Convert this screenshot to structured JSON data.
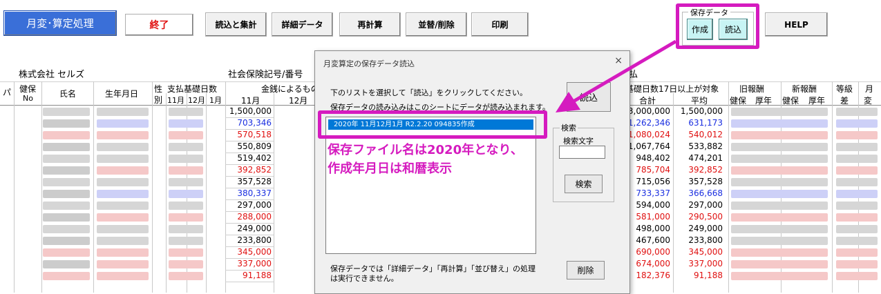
{
  "toolbar": {
    "main_label": "月変･算定処理",
    "end_label": "終了",
    "read_sum_label": "読込と集計",
    "detail_label": "詳細データ",
    "recalc_label": "再計算",
    "sort_delete_label": "並替/削除",
    "print_label": "印刷",
    "saved_group_label": "保存データ",
    "create_label": "作成",
    "load_label": "読込",
    "help_label": "HELP"
  },
  "sheet": {
    "company": "株式会社  セルズ",
    "insurance_no_label": "社会保険記号/番号",
    "pay_label": "払",
    "col_pa": "パ",
    "col_kenpo": "健保",
    "col_no": "No",
    "col_name": "氏名",
    "col_birth": "生年月日",
    "col_sex_top": "性",
    "col_sex_bottom": "別",
    "col_days_title": "支払基礎日数",
    "col_m11": "11月",
    "col_m12": "12月",
    "col_m1": "1月",
    "col_money_title": "金銭によるもの",
    "col_money_11": "11月",
    "col_money_12": "12月",
    "col_17days": "基礎日数17日以上が対象",
    "col_total": "合計",
    "col_avg": "平均",
    "col_old": "旧報酬",
    "col_new": "新報酬",
    "col_grade": "等級",
    "col_month": "月",
    "col_kenpo2": "健保",
    "col_kosei": "厚年",
    "col_kenpo3": "健保",
    "col_kosei2": "厚年",
    "col_diff": "差",
    "col_change": "変",
    "money_11": [
      {
        "v": "1,500,000",
        "c": "#000000"
      },
      {
        "v": "703,346",
        "c": "#1a2ee0"
      },
      {
        "v": "570,518",
        "c": "#e01010"
      },
      {
        "v": "550,809",
        "c": "#000000"
      },
      {
        "v": "519,402",
        "c": "#000000"
      },
      {
        "v": "392,852",
        "c": "#e01010"
      },
      {
        "v": "357,528",
        "c": "#000000"
      },
      {
        "v": "380,337",
        "c": "#1a2ee0"
      },
      {
        "v": "297,000",
        "c": "#000000"
      },
      {
        "v": "288,000",
        "c": "#e01010"
      },
      {
        "v": "249,000",
        "c": "#000000"
      },
      {
        "v": "233,800",
        "c": "#000000"
      },
      {
        "v": "345,000",
        "c": "#e01010"
      },
      {
        "v": "337,000",
        "c": "#e01010"
      },
      {
        "v": "91,188",
        "c": "#e01010"
      }
    ],
    "totals": [
      {
        "v": "3,000,000",
        "c": "#000000"
      },
      {
        "v": "1,262,346",
        "c": "#1a2ee0"
      },
      {
        "v": "1,080,024",
        "c": "#e01010"
      },
      {
        "v": "1,067,764",
        "c": "#000000"
      },
      {
        "v": "948,402",
        "c": "#000000"
      },
      {
        "v": "785,704",
        "c": "#e01010"
      },
      {
        "v": "715,056",
        "c": "#000000"
      },
      {
        "v": "733,337",
        "c": "#1a2ee0"
      },
      {
        "v": "594,000",
        "c": "#000000"
      },
      {
        "v": "581,000",
        "c": "#e01010"
      },
      {
        "v": "498,000",
        "c": "#000000"
      },
      {
        "v": "467,600",
        "c": "#000000"
      },
      {
        "v": "690,000",
        "c": "#e01010"
      },
      {
        "v": "674,000",
        "c": "#e01010"
      },
      {
        "v": "182,376",
        "c": "#e01010"
      }
    ],
    "avgs": [
      {
        "v": "1,500,000",
        "c": "#000000"
      },
      {
        "v": "631,173",
        "c": "#1a2ee0"
      },
      {
        "v": "540,012",
        "c": "#e01010"
      },
      {
        "v": "533,882",
        "c": "#000000"
      },
      {
        "v": "474,201",
        "c": "#000000"
      },
      {
        "v": "392,852",
        "c": "#e01010"
      },
      {
        "v": "357,528",
        "c": "#000000"
      },
      {
        "v": "366,668",
        "c": "#1a2ee0"
      },
      {
        "v": "297,000",
        "c": "#000000"
      },
      {
        "v": "290,500",
        "c": "#e01010"
      },
      {
        "v": "249,000",
        "c": "#000000"
      },
      {
        "v": "233,800",
        "c": "#000000"
      },
      {
        "v": "345,000",
        "c": "#e01010"
      },
      {
        "v": "337,000",
        "c": "#e01010"
      },
      {
        "v": "91,188",
        "c": "#e01010"
      }
    ]
  },
  "dialog": {
    "title": "月変算定の保存データ読込",
    "close": "×",
    "instruction1": "下のリストを選択して「読込」をクリックしてください。",
    "instruction2": "保存データの読み込みはこのシートにデータが読み込まれます。",
    "load_button": "読込",
    "list_item": "2020年 11月12月1月  R2.2.20 094835作成",
    "search_group": "検索",
    "search_text_label": "検索文字",
    "search_button": "検索",
    "note": "保存データでは「詳細データ」「再計算」「並び替え」の処理は実行できません。",
    "delete_button": "削除"
  },
  "annotation": {
    "line1": "保存ファイル名は2020年となり、",
    "line2": "作成年月日は和暦表示"
  },
  "colors": {
    "highlight": "#d51bbf",
    "main_button": "#3a6fd8",
    "selection": "#0078d7"
  }
}
